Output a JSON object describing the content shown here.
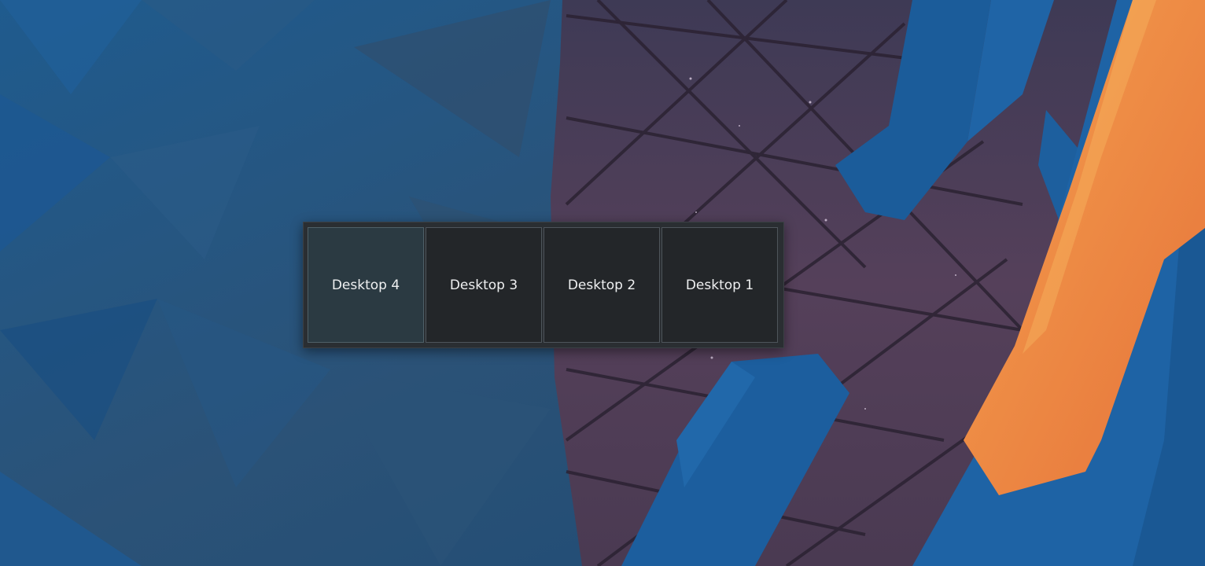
{
  "colors": {
    "wallpaper_blue": "#1d4f7c",
    "wallpaper_purple": "#4d3c55",
    "accent_orange": "#f08a3c",
    "switcher_bg": "#2a2e32",
    "tile_bg": "#232629",
    "tile_current_bg": "#2b3a42",
    "text": "#eff0f1"
  },
  "switcher": {
    "desktops": [
      {
        "label": "Desktop 4",
        "current": true
      },
      {
        "label": "Desktop 3",
        "current": false
      },
      {
        "label": "Desktop 2",
        "current": false
      },
      {
        "label": "Desktop 1",
        "current": false
      }
    ]
  }
}
